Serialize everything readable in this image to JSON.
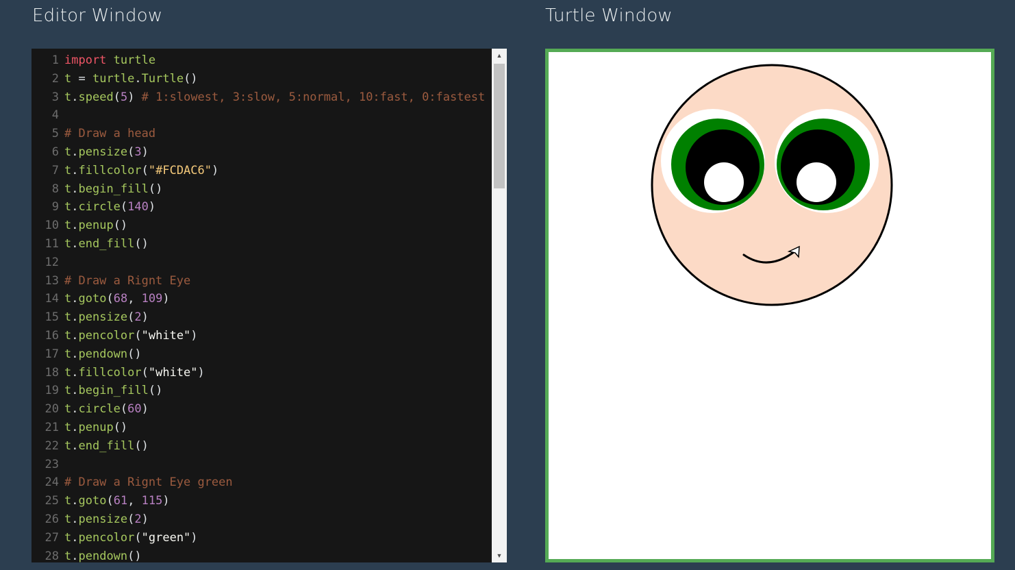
{
  "editor": {
    "title": "Editor Window",
    "lines": [
      {
        "n": "1",
        "tokens": [
          {
            "t": "import",
            "c": "kw"
          },
          {
            "t": " ",
            "c": "op"
          },
          {
            "t": "turtle",
            "c": "id"
          }
        ]
      },
      {
        "n": "2",
        "tokens": [
          {
            "t": "t",
            "c": "id"
          },
          {
            "t": " = ",
            "c": "op"
          },
          {
            "t": "turtle",
            "c": "id"
          },
          {
            "t": ".",
            "c": "op"
          },
          {
            "t": "Turtle",
            "c": "id"
          },
          {
            "t": "()",
            "c": "op"
          }
        ]
      },
      {
        "n": "3",
        "tokens": [
          {
            "t": "t",
            "c": "id"
          },
          {
            "t": ".",
            "c": "op"
          },
          {
            "t": "speed",
            "c": "id"
          },
          {
            "t": "(",
            "c": "op"
          },
          {
            "t": "5",
            "c": "num"
          },
          {
            "t": ") ",
            "c": "op"
          },
          {
            "t": "# 1:slowest, 3:slow, 5:normal, 10:fast, 0:fastest",
            "c": "cmt"
          }
        ]
      },
      {
        "n": "4",
        "tokens": []
      },
      {
        "n": "5",
        "tokens": [
          {
            "t": "# Draw a head",
            "c": "cmt"
          }
        ]
      },
      {
        "n": "6",
        "tokens": [
          {
            "t": "t",
            "c": "id"
          },
          {
            "t": ".",
            "c": "op"
          },
          {
            "t": "pensize",
            "c": "id"
          },
          {
            "t": "(",
            "c": "op"
          },
          {
            "t": "3",
            "c": "num"
          },
          {
            "t": ")",
            "c": "op"
          }
        ]
      },
      {
        "n": "7",
        "tokens": [
          {
            "t": "t",
            "c": "id"
          },
          {
            "t": ".",
            "c": "op"
          },
          {
            "t": "fillcolor",
            "c": "id"
          },
          {
            "t": "(",
            "c": "op"
          },
          {
            "t": "\"#FCDAC6\"",
            "c": "sx"
          },
          {
            "t": ")",
            "c": "op"
          }
        ]
      },
      {
        "n": "8",
        "tokens": [
          {
            "t": "t",
            "c": "id"
          },
          {
            "t": ".",
            "c": "op"
          },
          {
            "t": "begin_fill",
            "c": "id"
          },
          {
            "t": "()",
            "c": "op"
          }
        ]
      },
      {
        "n": "9",
        "tokens": [
          {
            "t": "t",
            "c": "id"
          },
          {
            "t": ".",
            "c": "op"
          },
          {
            "t": "circle",
            "c": "id"
          },
          {
            "t": "(",
            "c": "op"
          },
          {
            "t": "140",
            "c": "num"
          },
          {
            "t": ")",
            "c": "op"
          }
        ]
      },
      {
        "n": "10",
        "tokens": [
          {
            "t": "t",
            "c": "id"
          },
          {
            "t": ".",
            "c": "op"
          },
          {
            "t": "penup",
            "c": "id"
          },
          {
            "t": "()",
            "c": "op"
          }
        ]
      },
      {
        "n": "11",
        "tokens": [
          {
            "t": "t",
            "c": "id"
          },
          {
            "t": ".",
            "c": "op"
          },
          {
            "t": "end_fill",
            "c": "id"
          },
          {
            "t": "()",
            "c": "op"
          }
        ]
      },
      {
        "n": "12",
        "tokens": []
      },
      {
        "n": "13",
        "tokens": [
          {
            "t": "# Draw a Rignt Eye",
            "c": "cmt"
          }
        ]
      },
      {
        "n": "14",
        "tokens": [
          {
            "t": "t",
            "c": "id"
          },
          {
            "t": ".",
            "c": "op"
          },
          {
            "t": "goto",
            "c": "id"
          },
          {
            "t": "(",
            "c": "op"
          },
          {
            "t": "68",
            "c": "num"
          },
          {
            "t": ", ",
            "c": "op"
          },
          {
            "t": "109",
            "c": "num"
          },
          {
            "t": ")",
            "c": "op"
          }
        ]
      },
      {
        "n": "15",
        "tokens": [
          {
            "t": "t",
            "c": "id"
          },
          {
            "t": ".",
            "c": "op"
          },
          {
            "t": "pensize",
            "c": "id"
          },
          {
            "t": "(",
            "c": "op"
          },
          {
            "t": "2",
            "c": "num"
          },
          {
            "t": ")",
            "c": "op"
          }
        ]
      },
      {
        "n": "16",
        "tokens": [
          {
            "t": "t",
            "c": "id"
          },
          {
            "t": ".",
            "c": "op"
          },
          {
            "t": "pencolor",
            "c": "id"
          },
          {
            "t": "(",
            "c": "op"
          },
          {
            "t": "\"white\"",
            "c": "str"
          },
          {
            "t": ")",
            "c": "op"
          }
        ]
      },
      {
        "n": "17",
        "tokens": [
          {
            "t": "t",
            "c": "id"
          },
          {
            "t": ".",
            "c": "op"
          },
          {
            "t": "pendown",
            "c": "id"
          },
          {
            "t": "()",
            "c": "op"
          }
        ]
      },
      {
        "n": "18",
        "tokens": [
          {
            "t": "t",
            "c": "id"
          },
          {
            "t": ".",
            "c": "op"
          },
          {
            "t": "fillcolor",
            "c": "id"
          },
          {
            "t": "(",
            "c": "op"
          },
          {
            "t": "\"white\"",
            "c": "str"
          },
          {
            "t": ")",
            "c": "op"
          }
        ]
      },
      {
        "n": "19",
        "tokens": [
          {
            "t": "t",
            "c": "id"
          },
          {
            "t": ".",
            "c": "op"
          },
          {
            "t": "begin_fill",
            "c": "id"
          },
          {
            "t": "()",
            "c": "op"
          }
        ]
      },
      {
        "n": "20",
        "tokens": [
          {
            "t": "t",
            "c": "id"
          },
          {
            "t": ".",
            "c": "op"
          },
          {
            "t": "circle",
            "c": "id"
          },
          {
            "t": "(",
            "c": "op"
          },
          {
            "t": "60",
            "c": "num"
          },
          {
            "t": ")",
            "c": "op"
          }
        ]
      },
      {
        "n": "21",
        "tokens": [
          {
            "t": "t",
            "c": "id"
          },
          {
            "t": ".",
            "c": "op"
          },
          {
            "t": "penup",
            "c": "id"
          },
          {
            "t": "()",
            "c": "op"
          }
        ]
      },
      {
        "n": "22",
        "tokens": [
          {
            "t": "t",
            "c": "id"
          },
          {
            "t": ".",
            "c": "op"
          },
          {
            "t": "end_fill",
            "c": "id"
          },
          {
            "t": "()",
            "c": "op"
          }
        ]
      },
      {
        "n": "23",
        "tokens": []
      },
      {
        "n": "24",
        "tokens": [
          {
            "t": "# Draw a Rignt Eye green",
            "c": "cmt"
          }
        ]
      },
      {
        "n": "25",
        "tokens": [
          {
            "t": "t",
            "c": "id"
          },
          {
            "t": ".",
            "c": "op"
          },
          {
            "t": "goto",
            "c": "id"
          },
          {
            "t": "(",
            "c": "op"
          },
          {
            "t": "61",
            "c": "num"
          },
          {
            "t": ", ",
            "c": "op"
          },
          {
            "t": "115",
            "c": "num"
          },
          {
            "t": ")",
            "c": "op"
          }
        ]
      },
      {
        "n": "26",
        "tokens": [
          {
            "t": "t",
            "c": "id"
          },
          {
            "t": ".",
            "c": "op"
          },
          {
            "t": "pensize",
            "c": "id"
          },
          {
            "t": "(",
            "c": "op"
          },
          {
            "t": "2",
            "c": "num"
          },
          {
            "t": ")",
            "c": "op"
          }
        ]
      },
      {
        "n": "27",
        "tokens": [
          {
            "t": "t",
            "c": "id"
          },
          {
            "t": ".",
            "c": "op"
          },
          {
            "t": "pencolor",
            "c": "id"
          },
          {
            "t": "(",
            "c": "op"
          },
          {
            "t": "\"green\"",
            "c": "str"
          },
          {
            "t": ")",
            "c": "op"
          }
        ]
      },
      {
        "n": "28",
        "tokens": [
          {
            "t": "t",
            "c": "id"
          },
          {
            "t": ".",
            "c": "op"
          },
          {
            "t": "pendown",
            "c": "id"
          },
          {
            "t": "()",
            "c": "op"
          }
        ]
      }
    ],
    "scrollbar": {
      "up_icon": "▲",
      "down_icon": "▼",
      "thumb_fraction": 0.25
    }
  },
  "turtle": {
    "title": "Turtle Window",
    "colors": {
      "frame": "#55aa55",
      "canvas": "#ffffff",
      "head_fill": "#FCDAC6",
      "head_outline": "#000000",
      "eye_white": "#ffffff",
      "iris": "#008000",
      "pupil": "#000000",
      "highlight": "#ffffff",
      "smile": "#000000"
    },
    "icons": [
      "turtle-cursor-arrow-icon"
    ]
  }
}
